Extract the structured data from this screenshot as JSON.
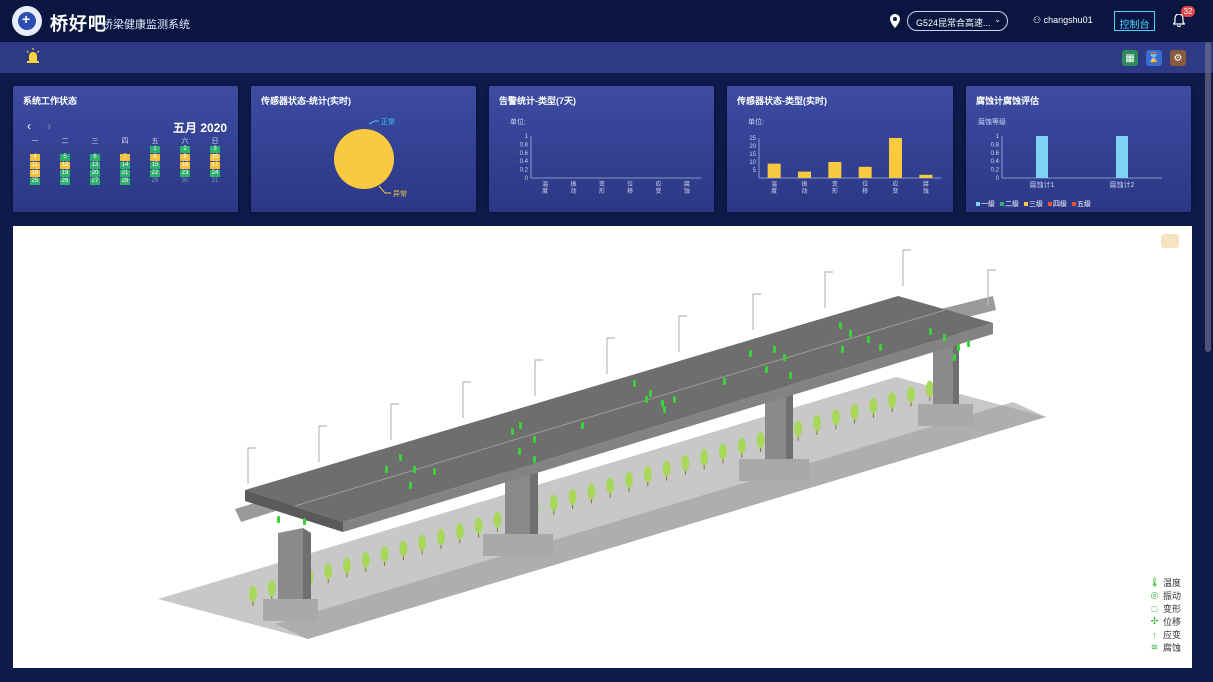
{
  "header": {
    "app_title": "桥好吧",
    "app_subtitle": "桥梁健康监测系统",
    "site_selector": "G524昆常合高速...",
    "user": "changshu01",
    "console_label": "控制台",
    "notification_count": "32"
  },
  "panels": {
    "system_status": {
      "title": "系统工作状态",
      "month_label": "五月 2020",
      "weekdays": [
        "一",
        "二",
        "三",
        "四",
        "五",
        "六",
        "日"
      ],
      "weeks": [
        [
          "",
          "",
          "",
          "",
          "1",
          "2",
          "3"
        ],
        [
          "4",
          "5",
          "6",
          "7",
          "8",
          "9",
          "10"
        ],
        [
          "11",
          "12",
          "13",
          "14",
          "15",
          "16",
          "17"
        ],
        [
          "18",
          "19",
          "20",
          "21",
          "22",
          "23",
          "24"
        ],
        [
          "25",
          "26",
          "27",
          "28",
          "29",
          "30",
          "31"
        ]
      ],
      "colors": {
        "normal": "#2db36b",
        "warning": "#f5c13b",
        "inactive": "#5f6ba8"
      }
    },
    "sensor_status_stats": {
      "title": "传感器状态-统计(实时)",
      "legend_normal": "正常",
      "legend_abnormal": "异常",
      "chart_data": {
        "type": "pie",
        "labels": [
          "正常",
          "异常"
        ],
        "values": [
          0,
          1
        ],
        "colors": [
          "#3ac7ff",
          "#f9c940"
        ]
      }
    },
    "alarm_stats": {
      "title": "告警统计-类型(7天)",
      "unit_label": "单位:",
      "chart_data": {
        "type": "bar",
        "categories": [
          "温度",
          "振动",
          "变形",
          "位移",
          "应变",
          "腐蚀"
        ],
        "values": [
          0,
          0,
          0,
          0,
          0,
          0
        ],
        "ylim": [
          0,
          1
        ],
        "yticks": [
          "0",
          "0.2",
          "0.4",
          "0.6",
          "0.8",
          "1"
        ]
      }
    },
    "sensor_status_type": {
      "title": "传感器状态-类型(实时)",
      "unit_label": "单位:",
      "chart_data": {
        "type": "bar",
        "categories": [
          "温度",
          "振动",
          "变形",
          "位移",
          "应变",
          "腐蚀"
        ],
        "values": [
          9,
          4,
          10,
          7,
          26,
          2
        ],
        "ylim": [
          0,
          25
        ],
        "yticks": [
          "5",
          "10",
          "15",
          "20",
          "25"
        ],
        "color": "#f9c940"
      }
    },
    "corrosion": {
      "title": "腐蚀计腐蚀评估",
      "unit_label": "腐蚀等级",
      "legend": [
        "一级",
        "二级",
        "三级",
        "四级",
        "五级"
      ],
      "legend_colors": [
        "#7ed3f5",
        "#2db36b",
        "#f9c940",
        "#e8562e",
        "#e8562e"
      ],
      "chart_data": {
        "type": "bar",
        "categories": [
          "腐蚀计1",
          "腐蚀计2"
        ],
        "values": [
          1,
          1
        ],
        "ylim": [
          0,
          1
        ],
        "yticks": [
          "0",
          "0.2",
          "0.4",
          "0.6",
          "0.8",
          "1"
        ],
        "color": "#7ed3f5"
      }
    }
  },
  "model_legend": [
    {
      "icon": "thermometer-icon",
      "glyph": "🌡",
      "label": "温度"
    },
    {
      "icon": "vibration-icon",
      "glyph": "◎",
      "label": "振动"
    },
    {
      "icon": "deformation-icon",
      "glyph": "□",
      "label": "变形"
    },
    {
      "icon": "displacement-icon",
      "glyph": "✣",
      "label": "位移"
    },
    {
      "icon": "strain-icon",
      "glyph": "↑",
      "label": "应变"
    },
    {
      "icon": "corrosion-icon",
      "glyph": "≋",
      "label": "腐蚀"
    }
  ]
}
